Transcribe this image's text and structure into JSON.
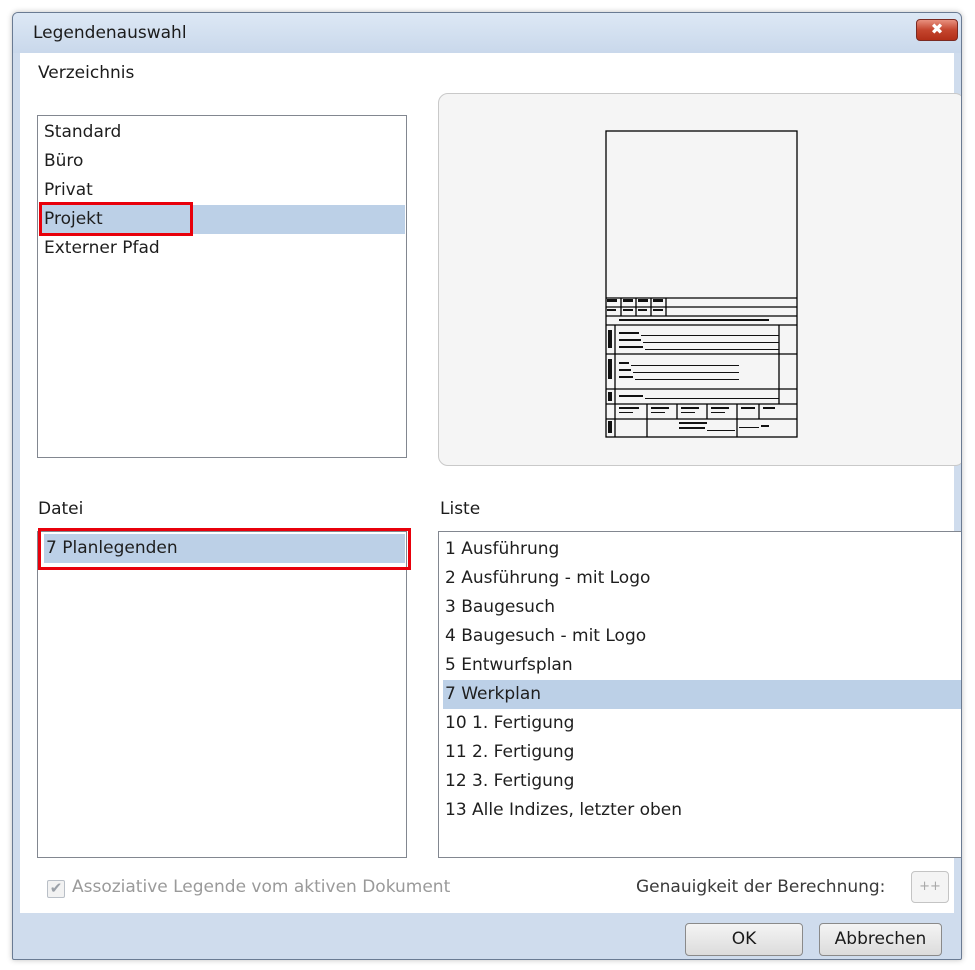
{
  "window": {
    "title": "Legendenauswahl",
    "close_glyph": "✖"
  },
  "verzeichnis": {
    "label": "Verzeichnis",
    "items": [
      {
        "label": "Standard"
      },
      {
        "label": "Büro"
      },
      {
        "label": "Privat"
      },
      {
        "label": "Projekt"
      },
      {
        "label": "Externer Pfad"
      }
    ],
    "selected": "Projekt"
  },
  "datei": {
    "label": "Datei",
    "items": [
      {
        "label": "7 Planlegenden"
      }
    ],
    "selected": "7 Planlegenden"
  },
  "liste": {
    "label": "Liste",
    "items": [
      {
        "label": "1 Ausführung"
      },
      {
        "label": "2 Ausführung - mit Logo"
      },
      {
        "label": "3 Baugesuch"
      },
      {
        "label": "4 Baugesuch - mit Logo"
      },
      {
        "label": "5 Entwurfsplan"
      },
      {
        "label": "7 Werkplan"
      },
      {
        "label": "10 1. Fertigung"
      },
      {
        "label": "11 2. Fertigung"
      },
      {
        "label": "12 3. Fertigung"
      },
      {
        "label": "13 Alle Indizes, letzter oben"
      }
    ],
    "selected": "7 Werkplan"
  },
  "associative": {
    "label": "Assoziative Legende vom aktiven Dokument",
    "checked": true,
    "enabled": false
  },
  "accuracy": {
    "label": "Genauigkeit der Berechnung:",
    "button_label": "++"
  },
  "buttons": {
    "ok": "OK",
    "cancel": "Abbrechen"
  },
  "colors": {
    "selection": "#bcd0e7",
    "highlight": "#e8000b",
    "frame": "#cfdced"
  }
}
